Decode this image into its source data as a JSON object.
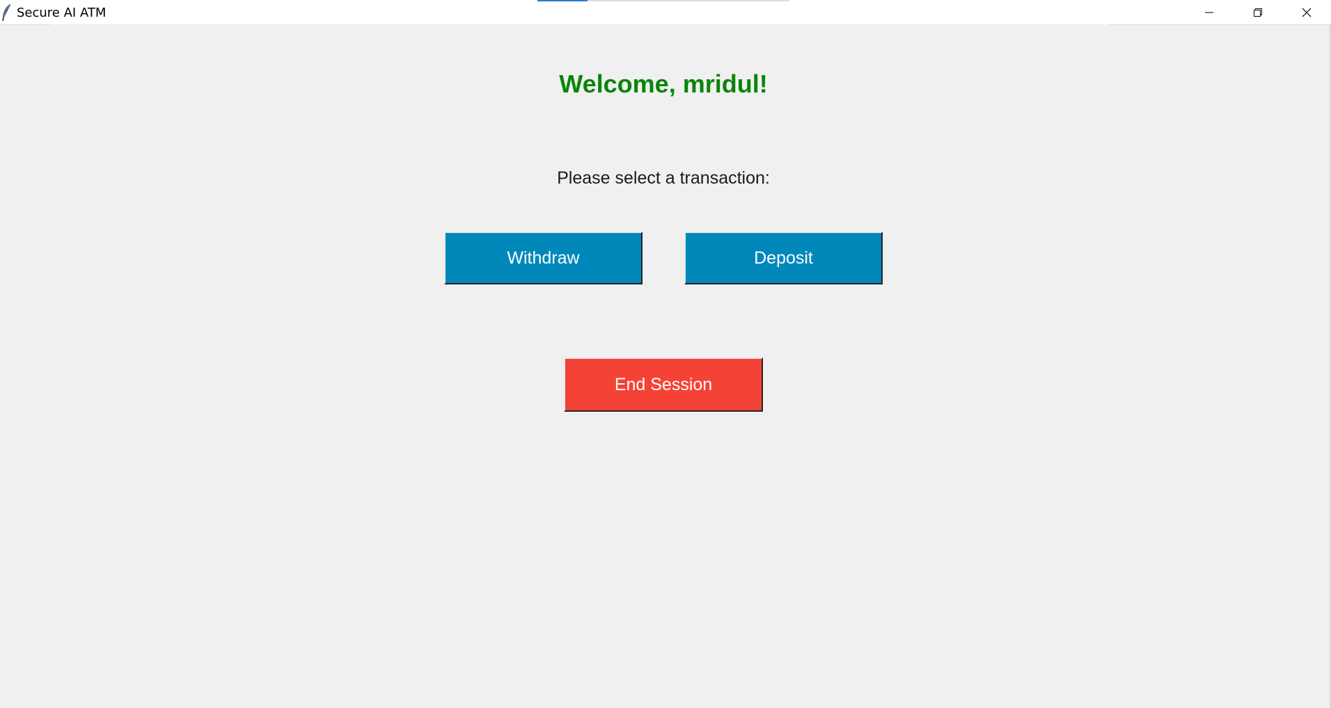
{
  "window": {
    "title": "Secure AI ATM",
    "controls": {
      "minimize": "minimize-icon",
      "maximize": "restore-icon",
      "close": "close-icon"
    }
  },
  "main": {
    "welcome": "Welcome, mridul!",
    "prompt": "Please select a transaction:",
    "buttons": {
      "withdraw": "Withdraw",
      "deposit": "Deposit",
      "end_session": "End Session"
    }
  },
  "colors": {
    "welcome_text": "#0a840a",
    "primary_button": "#0088bb",
    "danger_button": "#f44336",
    "background": "#f0f0f0"
  }
}
